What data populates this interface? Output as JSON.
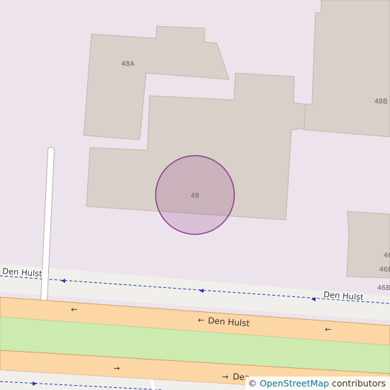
{
  "map": {
    "colors": {
      "residential": "#ede3ec",
      "building": "#d9d0c9",
      "building_outline": "#c4b6ab",
      "road": "#fcd6a4",
      "road_casing": "#c9a36b",
      "median": "#cdebb0",
      "pedestrian": "#f1efec",
      "path": "#ffffff",
      "highlight": "#8b3a8b"
    },
    "building_labels": {
      "b48a": "48A",
      "b48b": "48B",
      "b48": "48",
      "b46_1": "46",
      "b46_2": "46B",
      "b46_3": "46B"
    },
    "street_labels": {
      "left": "Den Hulst",
      "right": "Den Hulst",
      "road_upper": "Den Hulst",
      "road_lower": "Den"
    },
    "arrows": {
      "left": "←",
      "right": "→"
    }
  },
  "attribution": {
    "symbol": "©",
    "link_text": "OpenStreetMap",
    "suffix": "contributors"
  }
}
